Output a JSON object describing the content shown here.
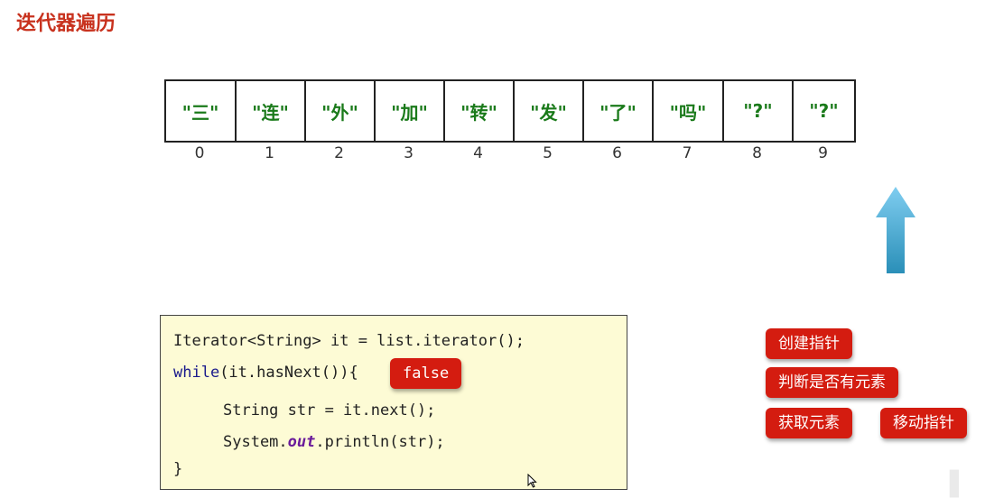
{
  "title": "迭代器遍历",
  "array": {
    "cells": [
      "\"三\"",
      "\"连\"",
      "\"外\"",
      "\"加\"",
      "\"转\"",
      "\"发\"",
      "\"了\"",
      "\"吗\"",
      "\"?\"",
      "\"?\""
    ],
    "indices": [
      "0",
      "1",
      "2",
      "3",
      "4",
      "5",
      "6",
      "7",
      "8",
      "9"
    ]
  },
  "code": {
    "line1": "Iterator<String> it = list.iterator();",
    "line2_kw": "while",
    "line2_rest": "(it.hasNext()){",
    "line3": "String str = it.next();",
    "line4_pre": "System.",
    "line4_out": "out",
    "line4_post": ".println(str);",
    "line5": "}",
    "false_badge": "false"
  },
  "legend": {
    "create_pointer": "创建指针",
    "check_element": "判断是否有元素",
    "get_element": "获取元素",
    "move_pointer": "移动指针"
  },
  "colors": {
    "title": "#c8321e",
    "cell_text": "#1a7a1a",
    "badge": "#d41c10",
    "code_bg": "#fdfbd5",
    "arrow": "#5ab4dc"
  },
  "icons": {
    "pointer_arrow": "up-arrow-icon",
    "mouse_cursor": "mouse-cursor-icon"
  }
}
